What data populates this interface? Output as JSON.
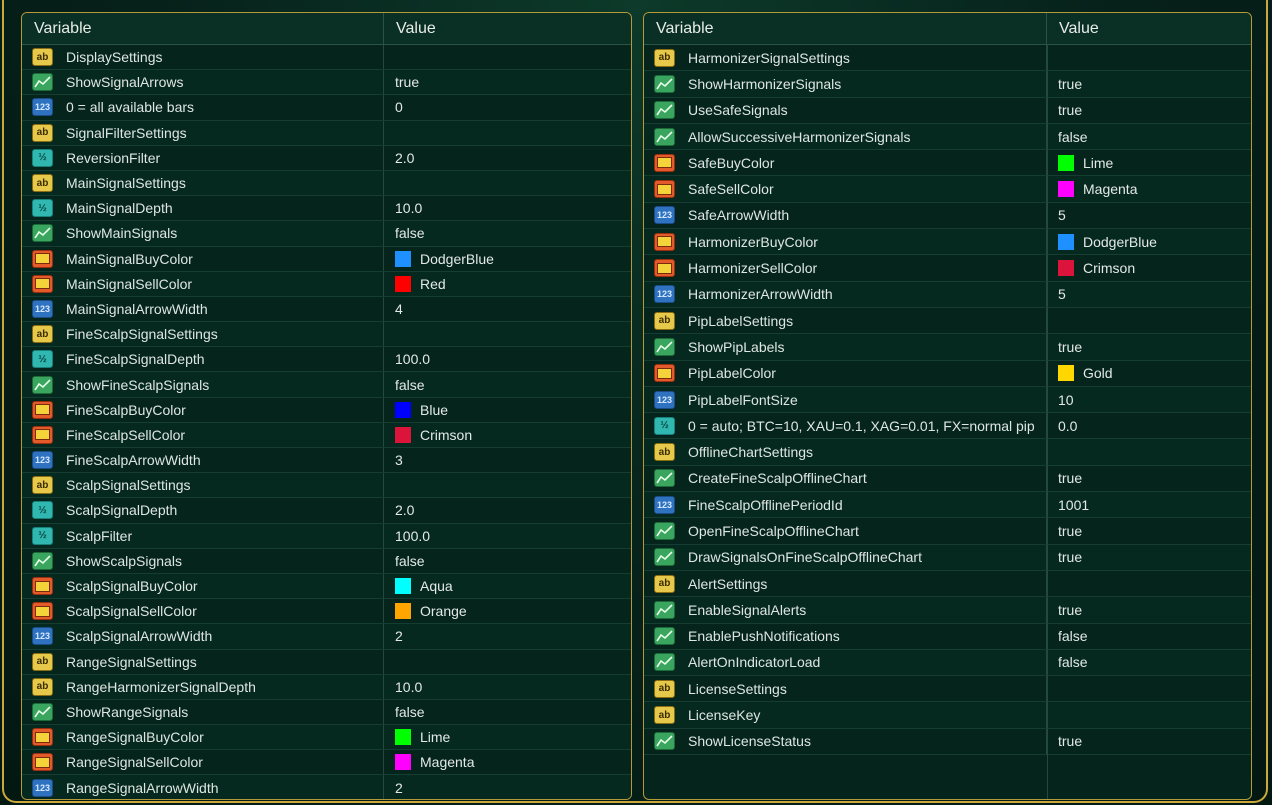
{
  "header": {
    "variable": "Variable",
    "value": "Value"
  },
  "left": [
    {
      "icon": "ab",
      "name": "DisplaySettings",
      "value": ""
    },
    {
      "icon": "trend",
      "name": "ShowSignalArrows",
      "value": "true"
    },
    {
      "icon": "int",
      "name": "0 = all available bars",
      "value": "0"
    },
    {
      "icon": "ab",
      "name": "SignalFilterSettings",
      "value": ""
    },
    {
      "icon": "dbl",
      "name": "ReversionFilter",
      "value": "2.0"
    },
    {
      "icon": "ab",
      "name": "MainSignalSettings",
      "value": ""
    },
    {
      "icon": "dbl",
      "name": "MainSignalDepth",
      "value": "10.0"
    },
    {
      "icon": "trend",
      "name": "ShowMainSignals",
      "value": "false"
    },
    {
      "icon": "col",
      "name": "MainSignalBuyColor",
      "value": "DodgerBlue",
      "swatch": "#1e90ff"
    },
    {
      "icon": "col",
      "name": "MainSignalSellColor",
      "value": "Red",
      "swatch": "#ff0000"
    },
    {
      "icon": "int",
      "name": "MainSignalArrowWidth",
      "value": "4"
    },
    {
      "icon": "ab",
      "name": "FineScalpSignalSettings",
      "value": ""
    },
    {
      "icon": "dbl",
      "name": "FineScalpSignalDepth",
      "value": "100.0"
    },
    {
      "icon": "trend",
      "name": "ShowFineScalpSignals",
      "value": "false"
    },
    {
      "icon": "col",
      "name": "FineScalpBuyColor",
      "value": "Blue",
      "swatch": "#0000ff"
    },
    {
      "icon": "col",
      "name": "FineScalpSellColor",
      "value": "Crimson",
      "swatch": "#dc143c"
    },
    {
      "icon": "int",
      "name": "FineScalpArrowWidth",
      "value": "3"
    },
    {
      "icon": "ab",
      "name": "ScalpSignalSettings",
      "value": ""
    },
    {
      "icon": "dbl",
      "name": "ScalpSignalDepth",
      "value": "2.0"
    },
    {
      "icon": "dbl",
      "name": "ScalpFilter",
      "value": "100.0"
    },
    {
      "icon": "trend",
      "name": "ShowScalpSignals",
      "value": "false"
    },
    {
      "icon": "col",
      "name": "ScalpSignalBuyColor",
      "value": "Aqua",
      "swatch": "#00ffff"
    },
    {
      "icon": "col",
      "name": "ScalpSignalSellColor",
      "value": "Orange",
      "swatch": "#ffa500"
    },
    {
      "icon": "int",
      "name": "ScalpSignalArrowWidth",
      "value": "2"
    },
    {
      "icon": "ab",
      "name": "RangeSignalSettings",
      "value": ""
    },
    {
      "icon": "ab",
      "name": "RangeHarmonizerSignalDepth",
      "value": "10.0"
    },
    {
      "icon": "trend",
      "name": "ShowRangeSignals",
      "value": "false"
    },
    {
      "icon": "col",
      "name": "RangeSignalBuyColor",
      "value": "Lime",
      "swatch": "#00ff00"
    },
    {
      "icon": "col",
      "name": "RangeSignalSellColor",
      "value": "Magenta",
      "swatch": "#ff00ff"
    },
    {
      "icon": "int",
      "name": "RangeSignalArrowWidth",
      "value": "2"
    }
  ],
  "right": [
    {
      "icon": "ab",
      "name": "HarmonizerSignalSettings",
      "value": ""
    },
    {
      "icon": "trend",
      "name": "ShowHarmonizerSignals",
      "value": "true"
    },
    {
      "icon": "trend",
      "name": "UseSafeSignals",
      "value": "true"
    },
    {
      "icon": "trend",
      "name": "AllowSuccessiveHarmonizerSignals",
      "value": "false"
    },
    {
      "icon": "col",
      "name": "SafeBuyColor",
      "value": "Lime",
      "swatch": "#00ff00"
    },
    {
      "icon": "col",
      "name": "SafeSellColor",
      "value": "Magenta",
      "swatch": "#ff00ff"
    },
    {
      "icon": "int",
      "name": "SafeArrowWidth",
      "value": "5"
    },
    {
      "icon": "col",
      "name": "HarmonizerBuyColor",
      "value": "DodgerBlue",
      "swatch": "#1e90ff"
    },
    {
      "icon": "col",
      "name": "HarmonizerSellColor",
      "value": "Crimson",
      "swatch": "#dc143c"
    },
    {
      "icon": "int",
      "name": "HarmonizerArrowWidth",
      "value": "5"
    },
    {
      "icon": "ab",
      "name": "PipLabelSettings",
      "value": ""
    },
    {
      "icon": "trend",
      "name": "ShowPipLabels",
      "value": "true"
    },
    {
      "icon": "col",
      "name": "PipLabelColor",
      "value": "Gold",
      "swatch": "#ffd700"
    },
    {
      "icon": "int",
      "name": "PipLabelFontSize",
      "value": "10"
    },
    {
      "icon": "dbl",
      "name": "0 = auto; BTC=10, XAU=0.1, XAG=0.01, FX=normal pip",
      "value": "0.0"
    },
    {
      "icon": "ab",
      "name": "OfflineChartSettings",
      "value": ""
    },
    {
      "icon": "trend",
      "name": "CreateFineScalpOfflineChart",
      "value": "true"
    },
    {
      "icon": "int",
      "name": "FineScalpOfflinePeriodId",
      "value": "1001"
    },
    {
      "icon": "trend",
      "name": "OpenFineScalpOfflineChart",
      "value": "true"
    },
    {
      "icon": "trend",
      "name": "DrawSignalsOnFineScalpOfflineChart",
      "value": "true"
    },
    {
      "icon": "ab",
      "name": "AlertSettings",
      "value": ""
    },
    {
      "icon": "trend",
      "name": "EnableSignalAlerts",
      "value": "true"
    },
    {
      "icon": "trend",
      "name": "EnablePushNotifications",
      "value": "false"
    },
    {
      "icon": "trend",
      "name": "AlertOnIndicatorLoad",
      "value": "false"
    },
    {
      "icon": "ab",
      "name": "LicenseSettings",
      "value": ""
    },
    {
      "icon": "ab",
      "name": "LicenseKey",
      "value": ""
    },
    {
      "icon": "trend",
      "name": "ShowLicenseStatus",
      "value": "true"
    }
  ]
}
